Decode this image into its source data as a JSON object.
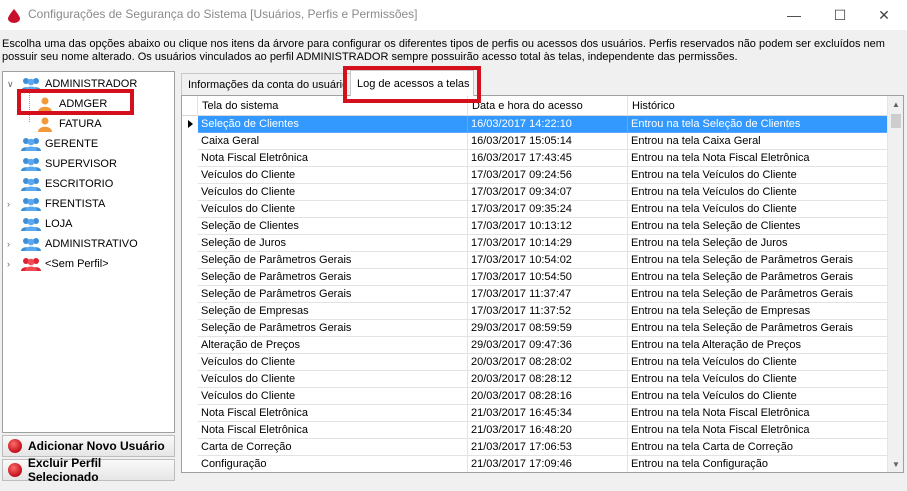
{
  "window": {
    "title": "Configurações de Segurança do Sistema [Usuários, Perfis e Permissões]",
    "minimize": "—",
    "maximize": "☐",
    "close": "✕"
  },
  "description": "Escolha uma das opções abaixo ou clique nos itens da árvore para configurar os diferentes tipos de perfis ou acessos dos usuários. Perfis reservados não podem ser excluídos nem possuir seu nome alterado. Os usuários vinculados ao perfil ADMINISTRADOR sempre possuirão acesso total às telas, independente das permissões.",
  "tree": {
    "items": [
      {
        "label": "ADMINISTRADOR",
        "type": "group",
        "expanded": true
      },
      {
        "label": "ADMGER",
        "type": "user",
        "selected": true
      },
      {
        "label": "FATURA",
        "type": "user"
      },
      {
        "label": "GERENTE",
        "type": "group"
      },
      {
        "label": "SUPERVISOR",
        "type": "group"
      },
      {
        "label": "ESCRITORIO",
        "type": "group"
      },
      {
        "label": "FRENTISTA",
        "type": "group",
        "expandable": true
      },
      {
        "label": "LOJA",
        "type": "group"
      },
      {
        "label": "ADMINISTRATIVO",
        "type": "group",
        "expandable": true
      },
      {
        "label": "<Sem Perfil>",
        "type": "group-red",
        "expandable": true
      }
    ]
  },
  "actions": {
    "add_user": "Adicionar Novo Usuário",
    "delete_profile": "Excluir Perfil Selecionado"
  },
  "tabs": {
    "info": "Informações da conta do usuário",
    "log": "Log de acessos a telas"
  },
  "grid": {
    "columns": [
      "Tela do sistema",
      "Data e hora do acesso",
      "Histórico"
    ],
    "rows": [
      [
        "Seleção de Clientes",
        "16/03/2017 14:22:10",
        "Entrou na tela Seleção de Clientes"
      ],
      [
        "Caixa Geral",
        "16/03/2017 15:05:14",
        "Entrou na tela Caixa Geral"
      ],
      [
        "Nota Fiscal Eletrônica",
        "16/03/2017 17:43:45",
        "Entrou na tela Nota Fiscal Eletrônica"
      ],
      [
        "Veículos do Cliente",
        "17/03/2017 09:24:56",
        "Entrou na tela Veículos do Cliente"
      ],
      [
        "Veículos do Cliente",
        "17/03/2017 09:34:07",
        "Entrou na tela Veículos do Cliente"
      ],
      [
        "Veículos do Cliente",
        "17/03/2017 09:35:24",
        "Entrou na tela Veículos do Cliente"
      ],
      [
        "Seleção de Clientes",
        "17/03/2017 10:13:12",
        "Entrou na tela Seleção de Clientes"
      ],
      [
        "Seleção de Juros",
        "17/03/2017 10:14:29",
        "Entrou na tela Seleção de Juros"
      ],
      [
        "Seleção de Parâmetros Gerais",
        "17/03/2017 10:54:02",
        "Entrou na tela Seleção de Parâmetros Gerais"
      ],
      [
        "Seleção de Parâmetros Gerais",
        "17/03/2017 10:54:50",
        "Entrou na tela Seleção de Parâmetros Gerais"
      ],
      [
        "Seleção de Parâmetros Gerais",
        "17/03/2017 11:37:47",
        "Entrou na tela Seleção de Parâmetros Gerais"
      ],
      [
        "Seleção de Empresas",
        "17/03/2017 11:37:52",
        "Entrou na tela Seleção de Empresas"
      ],
      [
        "Seleção de Parâmetros Gerais",
        "29/03/2017 08:59:59",
        "Entrou na tela Seleção de Parâmetros Gerais"
      ],
      [
        "Alteração de Preços",
        "29/03/2017 09:47:36",
        "Entrou na tela Alteração de Preços"
      ],
      [
        "Veículos do Cliente",
        "20/03/2017 08:28:02",
        "Entrou na tela Veículos do Cliente"
      ],
      [
        "Veículos do Cliente",
        "20/03/2017 08:28:12",
        "Entrou na tela Veículos do Cliente"
      ],
      [
        "Veículos do Cliente",
        "20/03/2017 08:28:16",
        "Entrou na tela Veículos do Cliente"
      ],
      [
        "Nota Fiscal Eletrônica",
        "21/03/2017 16:45:34",
        "Entrou na tela Nota Fiscal Eletrônica"
      ],
      [
        "Nota Fiscal Eletrônica",
        "21/03/2017 16:48:20",
        "Entrou na tela Nota Fiscal Eletrônica"
      ],
      [
        "Carta de Correção",
        "21/03/2017 17:06:53",
        "Entrou na tela Carta de Correção"
      ],
      [
        "Configuração",
        "21/03/2017 17:09:46",
        "Entrou na tela Configuração"
      ]
    ],
    "selected_row": 0
  },
  "colors": {
    "selection": "#3399ff",
    "highlight_box": "#d3101c",
    "group_icon": "#3d8fd8",
    "user_icon": "#f2993a"
  }
}
